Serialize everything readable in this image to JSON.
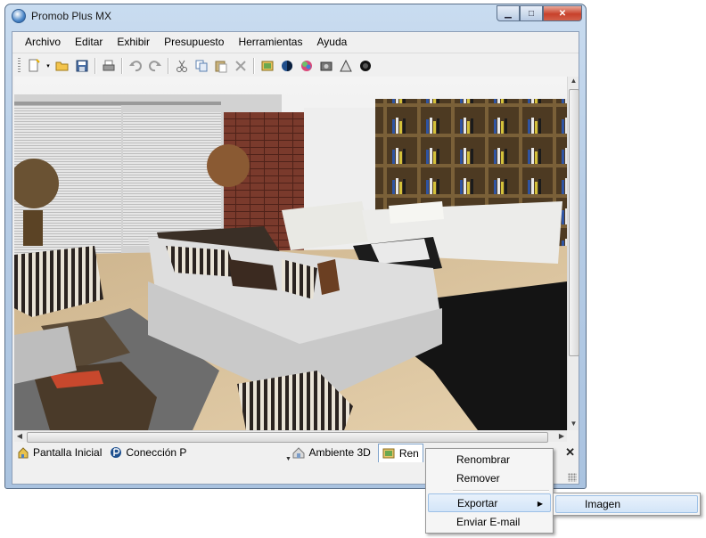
{
  "window": {
    "title": "Promob Plus MX",
    "minimize": "▁",
    "maximize": "□",
    "close": "✕"
  },
  "menubar": {
    "items": [
      "Archivo",
      "Editar",
      "Exhibir",
      "Presupuesto",
      "Herramientas",
      "Ayuda"
    ]
  },
  "toolbar": {
    "icons": [
      "new-icon",
      "open-icon",
      "save-icon",
      "print-icon",
      "undo-icon",
      "redo-icon",
      "cut-icon",
      "copy-icon",
      "paste-icon",
      "delete-icon",
      "render-icon",
      "sphere-shading-icon",
      "color-sphere-icon",
      "camera-icon",
      "perspective-icon",
      "shadow-icon"
    ]
  },
  "tabs": [
    {
      "label": "Pantalla Inicial",
      "icon": "home-icon"
    },
    {
      "label": "Conección P",
      "icon": "promob-icon"
    },
    {
      "label": "Ambiente 3D",
      "icon": "environment-icon"
    },
    {
      "label": "Ren",
      "icon": "render-image-icon"
    }
  ],
  "context_menu": {
    "items": [
      "Renombrar",
      "Remover",
      "Exportar",
      "Enviar E-mail"
    ],
    "highlighted": "Exportar"
  },
  "submenu": {
    "items": [
      "Imagen"
    ]
  },
  "colors": {
    "accent": "#3399ff",
    "highlight": "#d3e5f8"
  }
}
